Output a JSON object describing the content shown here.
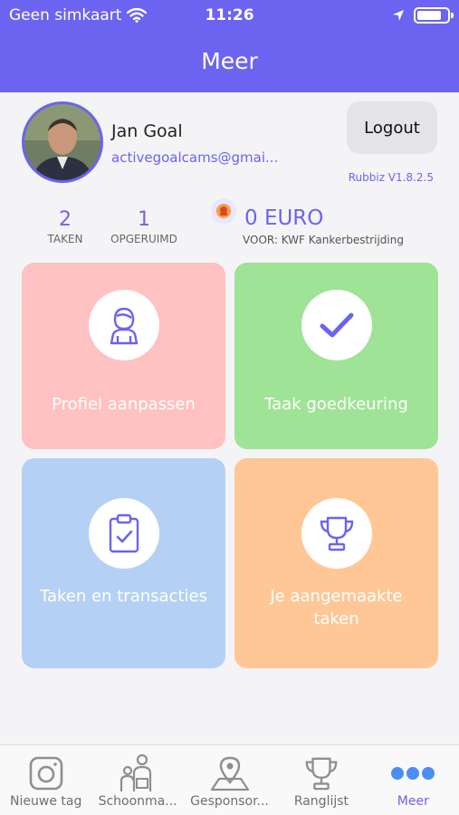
{
  "status": {
    "carrier": "Geen simkaart",
    "time": "11:26"
  },
  "header": {
    "title": "Meer"
  },
  "profile": {
    "name": "Jan Goal",
    "email": "activegoalcams@gmai...",
    "logout_label": "Logout",
    "version": "Rubbiz V1.8.2.5"
  },
  "stats": [
    {
      "value": "2",
      "label": "TAKEN"
    },
    {
      "value": "1",
      "label": "OPGERUIMD"
    }
  ],
  "donation": {
    "amount": "0 EURO",
    "for_label": "VOOR:",
    "charity": "KWF Kankerbestrijding"
  },
  "tiles": [
    {
      "label": "Profiel aanpassen",
      "icon": "person-icon",
      "color": "#ffc1c1"
    },
    {
      "label": "Taak goedkeuring",
      "icon": "checkmark-icon",
      "color": "#9fe396"
    },
    {
      "label": "Taken en transacties",
      "icon": "clipboard-icon",
      "color": "#b5d0f5"
    },
    {
      "label": "Je aangemaakte taken",
      "icon": "trophy-icon",
      "color": "#ffc796"
    }
  ],
  "tabs": [
    {
      "label": "Nieuwe tag",
      "icon": "camera-icon"
    },
    {
      "label": "Schoonma...",
      "icon": "cleaners-icon"
    },
    {
      "label": "Gesponsor...",
      "icon": "map-pin-icon"
    },
    {
      "label": "Ranglijst",
      "icon": "trophy-icon"
    },
    {
      "label": "Meer",
      "icon": "more-icon"
    }
  ],
  "colors": {
    "accent": "#6c63f0"
  }
}
